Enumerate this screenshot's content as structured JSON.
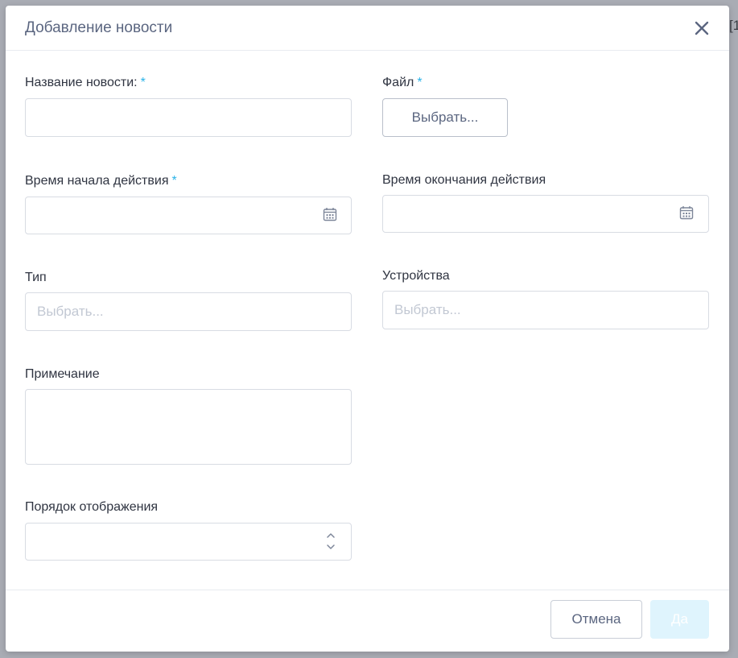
{
  "background": {
    "edge_text": "[1"
  },
  "dialog": {
    "title": "Добавление новости",
    "close_icon": "close-icon"
  },
  "form": {
    "news_name": {
      "label": "Название новости:",
      "required_mark": "*",
      "value": ""
    },
    "file": {
      "label": "Файл",
      "required_mark": "*",
      "button_label": "Выбрать..."
    },
    "start_time": {
      "label": "Время начала действия",
      "required_mark": "*",
      "value": "",
      "icon": "calendar-icon"
    },
    "end_time": {
      "label": "Время окончания действия",
      "value": "",
      "icon": "calendar-icon"
    },
    "type": {
      "label": "Тип",
      "placeholder": "Выбрать..."
    },
    "devices": {
      "label": "Устройства",
      "placeholder": "Выбрать..."
    },
    "note": {
      "label": "Примечание",
      "value": ""
    },
    "display_order": {
      "label": "Порядок отображения",
      "value": "",
      "icons": [
        "chevron-up-icon",
        "chevron-down-icon"
      ]
    }
  },
  "footer": {
    "cancel_label": "Отмена",
    "ok_label": "Да"
  },
  "colors": {
    "required_mark": "#2bb3e8",
    "title": "#5b6680",
    "ok_button_bg_disabled": "#dff4fd"
  }
}
